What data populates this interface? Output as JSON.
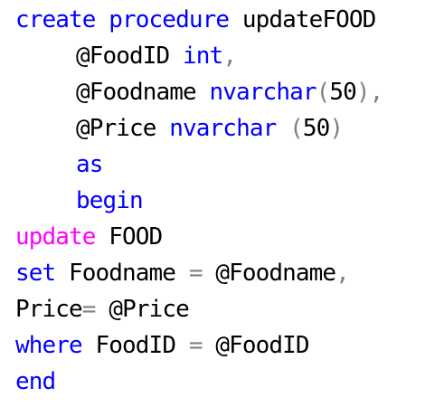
{
  "colors": {
    "keyword": "#0000ff",
    "function_keyword": "#ff00ff",
    "identifier": "#000000",
    "operator": "#808080",
    "background": "#ffffff"
  },
  "code": {
    "line1": {
      "kw1": "create",
      "kw2": "procedure",
      "name": "updateFOOD"
    },
    "line2": {
      "param": "@FoodID",
      "type": "int",
      "comma": ","
    },
    "line3": {
      "param": "@Foodname",
      "type": "nvarchar",
      "open": "(",
      "size": "50",
      "close": ")",
      "comma": ","
    },
    "line4": {
      "param": "@Price",
      "type": "nvarchar",
      "open": "(",
      "size": "50",
      "close": ")"
    },
    "line5": {
      "kw": "as"
    },
    "line6": {
      "kw": "begin"
    },
    "line7": {
      "kw": "update",
      "table": "FOOD"
    },
    "line8": {
      "kw": "set",
      "col": "Foodname",
      "eq": "=",
      "val": "@Foodname",
      "comma": ","
    },
    "line9": {
      "col": "Price",
      "eq": "=",
      "val": "@Price"
    },
    "line10": {
      "kw": "where",
      "col": "FoodID",
      "eq": "=",
      "val": "@FoodID"
    },
    "line11": {
      "kw": "end"
    }
  }
}
